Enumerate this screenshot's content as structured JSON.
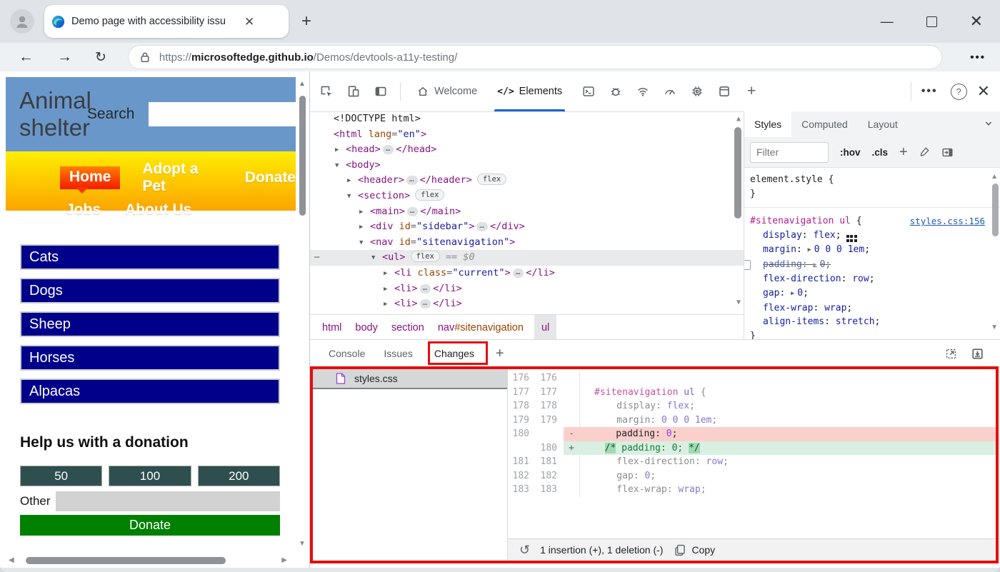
{
  "browser": {
    "tab_title": "Demo page with accessibility issu",
    "url_scheme": "https://",
    "url_host": "microsoftedge.github.io",
    "url_path": "/Demos/devtools-a11y-testing/"
  },
  "page": {
    "site_title": "Animal shelter",
    "search_label": "Search",
    "nav_row1": [
      "Home",
      "Adopt a Pet",
      "Donate"
    ],
    "nav_row2": [
      "Jobs",
      "About Us"
    ],
    "categories": [
      "Cats",
      "Dogs",
      "Sheep",
      "Horses",
      "Alpacas"
    ],
    "donation_heading": "Help us with a donation",
    "donation_amounts": [
      "50",
      "100",
      "200"
    ],
    "other_label": "Other",
    "donate_label": "Donate"
  },
  "devtools": {
    "toolbar": {
      "welcome_label": "Welcome",
      "elements_label": "Elements",
      "elements_icon": "</>"
    },
    "dom_rows": [
      {
        "lvl": 0,
        "t": [
          {
            "c": "doc",
            "v": "<!DOCTYPE html>"
          }
        ]
      },
      {
        "lvl": 0,
        "t": [
          {
            "c": "tag",
            "v": "<html"
          },
          {
            "c": "attr",
            "v": " lang"
          },
          {
            "c": "pun",
            "v": "="
          },
          {
            "c": "val",
            "v": "\"en\""
          },
          {
            "c": "tag",
            "v": ">"
          }
        ]
      },
      {
        "lvl": 1,
        "arrow": ">",
        "t": [
          {
            "c": "tag",
            "v": "<head>"
          },
          {
            "c": "ell"
          },
          {
            "c": "tag",
            "v": "</head>"
          }
        ]
      },
      {
        "lvl": 1,
        "arrow": "v",
        "t": [
          {
            "c": "tag",
            "v": "<body>"
          }
        ]
      },
      {
        "lvl": 2,
        "arrow": ">",
        "t": [
          {
            "c": "tag",
            "v": "<header>"
          },
          {
            "c": "ell"
          },
          {
            "c": "tag",
            "v": "</header>"
          },
          {
            "c": "badge",
            "v": "flex"
          }
        ]
      },
      {
        "lvl": 2,
        "arrow": "v",
        "t": [
          {
            "c": "tag",
            "v": "<section>"
          },
          {
            "c": "badge",
            "v": "flex"
          }
        ]
      },
      {
        "lvl": 3,
        "arrow": ">",
        "t": [
          {
            "c": "tag",
            "v": "<main>"
          },
          {
            "c": "ell"
          },
          {
            "c": "tag",
            "v": "</main>"
          }
        ]
      },
      {
        "lvl": 3,
        "arrow": ">",
        "t": [
          {
            "c": "tag",
            "v": "<div"
          },
          {
            "c": "attr",
            "v": " id"
          },
          {
            "c": "pun",
            "v": "="
          },
          {
            "c": "val",
            "v": "\"sidebar\""
          },
          {
            "c": "tag",
            "v": ">"
          },
          {
            "c": "ell"
          },
          {
            "c": "tag",
            "v": "</div>"
          }
        ]
      },
      {
        "lvl": 3,
        "arrow": "v",
        "t": [
          {
            "c": "tag",
            "v": "<nav"
          },
          {
            "c": "attr",
            "v": " id"
          },
          {
            "c": "pun",
            "v": "="
          },
          {
            "c": "val",
            "v": "\"sitenavigation\""
          },
          {
            "c": "tag",
            "v": ">"
          }
        ]
      },
      {
        "lvl": 4,
        "arrow": "v",
        "sel": true,
        "gutter": true,
        "t": [
          {
            "c": "tag",
            "v": "<ul>"
          },
          {
            "c": "badge",
            "v": "flex"
          },
          {
            "c": "eq",
            "v": "== $0"
          }
        ]
      },
      {
        "lvl": 5,
        "arrow": ">",
        "t": [
          {
            "c": "tag",
            "v": "<li"
          },
          {
            "c": "attr",
            "v": " class"
          },
          {
            "c": "pun",
            "v": "="
          },
          {
            "c": "val",
            "v": "\"current\""
          },
          {
            "c": "tag",
            "v": ">"
          },
          {
            "c": "ell"
          },
          {
            "c": "tag",
            "v": "</li>"
          }
        ]
      },
      {
        "lvl": 5,
        "arrow": ">",
        "t": [
          {
            "c": "tag",
            "v": "<li>"
          },
          {
            "c": "ell"
          },
          {
            "c": "tag",
            "v": "</li>"
          }
        ]
      },
      {
        "lvl": 5,
        "arrow": ">",
        "t": [
          {
            "c": "tag",
            "v": "<li>"
          },
          {
            "c": "ell"
          },
          {
            "c": "tag",
            "v": "</li>"
          }
        ]
      },
      {
        "lvl": 5,
        "arrow": ">",
        "t": [
          {
            "c": "tag",
            "v": "<li>"
          },
          {
            "c": "ell"
          },
          {
            "c": "tag",
            "v": "</li>"
          }
        ]
      }
    ],
    "breadcrumb": [
      {
        "parts": [
          {
            "c": "t",
            "v": "html"
          }
        ]
      },
      {
        "parts": [
          {
            "c": "t",
            "v": "body"
          }
        ]
      },
      {
        "parts": [
          {
            "c": "t",
            "v": "section"
          }
        ]
      },
      {
        "parts": [
          {
            "c": "t",
            "v": "nav"
          },
          {
            "c": "i",
            "v": "#sitenavigation"
          }
        ]
      },
      {
        "parts": [
          {
            "c": "t",
            "v": "ul"
          }
        ],
        "sel": true
      }
    ],
    "styles": {
      "tabs": [
        "Styles",
        "Computed",
        "Layout"
      ],
      "filter_placeholder": "Filter",
      "pseudo_label": ":hov",
      "class_label": ".cls",
      "element_style": {
        "open": "element.style {",
        "close": "}"
      },
      "rule": {
        "selector": "#sitenavigation ul",
        "open_brace": " {",
        "source_link": "styles.css:156",
        "close_brace": "}",
        "props": [
          {
            "name": "display",
            "value": "flex",
            "flexicon": true
          },
          {
            "name": "margin",
            "value": "0 0 0 1em",
            "arrow": true
          },
          {
            "name": "padding",
            "value": "0",
            "arrow": true,
            "disabled": true
          },
          {
            "name": "flex-direction",
            "value": "row"
          },
          {
            "name": "gap",
            "value": "0",
            "arrow": true
          },
          {
            "name": "flex-wrap",
            "value": "wrap"
          },
          {
            "name": "align-items",
            "value": "stretch"
          }
        ]
      }
    },
    "drawer": {
      "tabs": [
        "Console",
        "Issues",
        "Changes"
      ]
    },
    "changes": {
      "file_name": "styles.css",
      "rows": [
        {
          "old": "176",
          "new": "176",
          "kind": "ctx",
          "t": []
        },
        {
          "old": "177",
          "new": "177",
          "kind": "ctx",
          "t": [
            {
              "c": "dsel",
              "v": "#sitenavigation"
            },
            {
              "c": "dtag",
              "v": " ul"
            },
            {
              "c": "dpun",
              "v": " {"
            }
          ]
        },
        {
          "old": "178",
          "new": "178",
          "kind": "ctx",
          "t": [
            {
              "c": "dprop",
              "v": "    display"
            },
            {
              "c": "dpun",
              "v": ": "
            },
            {
              "c": "dval",
              "v": "flex"
            },
            {
              "c": "dpun",
              "v": ";"
            }
          ]
        },
        {
          "old": "179",
          "new": "179",
          "kind": "ctx",
          "t": [
            {
              "c": "dprop",
              "v": "    margin"
            },
            {
              "c": "dpun",
              "v": ": "
            },
            {
              "c": "dval",
              "v": "0 0 0 1em"
            },
            {
              "c": "dpun",
              "v": ";"
            }
          ]
        },
        {
          "old": "180",
          "new": "",
          "sign": "-",
          "kind": "del",
          "t": [
            {
              "c": "xprop",
              "v": "    padding"
            },
            {
              "c": "xpun",
              "v": ": "
            },
            {
              "c": "xval",
              "v": "0"
            },
            {
              "c": "xpun",
              "v": ";"
            }
          ]
        },
        {
          "old": "",
          "new": "180",
          "sign": "+",
          "kind": "add",
          "t": [
            {
              "c": "sp",
              "v": "  "
            },
            {
              "c": "cchip",
              "v": "/*"
            },
            {
              "c": "cmt",
              "v": " padding: 0; "
            },
            {
              "c": "cchip",
              "v": "*/"
            }
          ]
        },
        {
          "old": "181",
          "new": "181",
          "kind": "ctx",
          "t": [
            {
              "c": "dprop",
              "v": "    flex-direction"
            },
            {
              "c": "dpun",
              "v": ": "
            },
            {
              "c": "dval",
              "v": "row"
            },
            {
              "c": "dpun",
              "v": ";"
            }
          ]
        },
        {
          "old": "182",
          "new": "182",
          "kind": "ctx",
          "t": [
            {
              "c": "dprop",
              "v": "    gap"
            },
            {
              "c": "dpun",
              "v": ": "
            },
            {
              "c": "dval",
              "v": "0"
            },
            {
              "c": "dpun",
              "v": ";"
            }
          ]
        },
        {
          "old": "183",
          "new": "183",
          "kind": "ctx",
          "t": [
            {
              "c": "dprop",
              "v": "    flex-wrap"
            },
            {
              "c": "dpun",
              "v": ": "
            },
            {
              "c": "dval",
              "v": "wrap"
            },
            {
              "c": "dpun",
              "v": ";"
            }
          ]
        }
      ],
      "summary": "1 insertion (+), 1 deletion (-)",
      "copy_label": "Copy"
    }
  }
}
